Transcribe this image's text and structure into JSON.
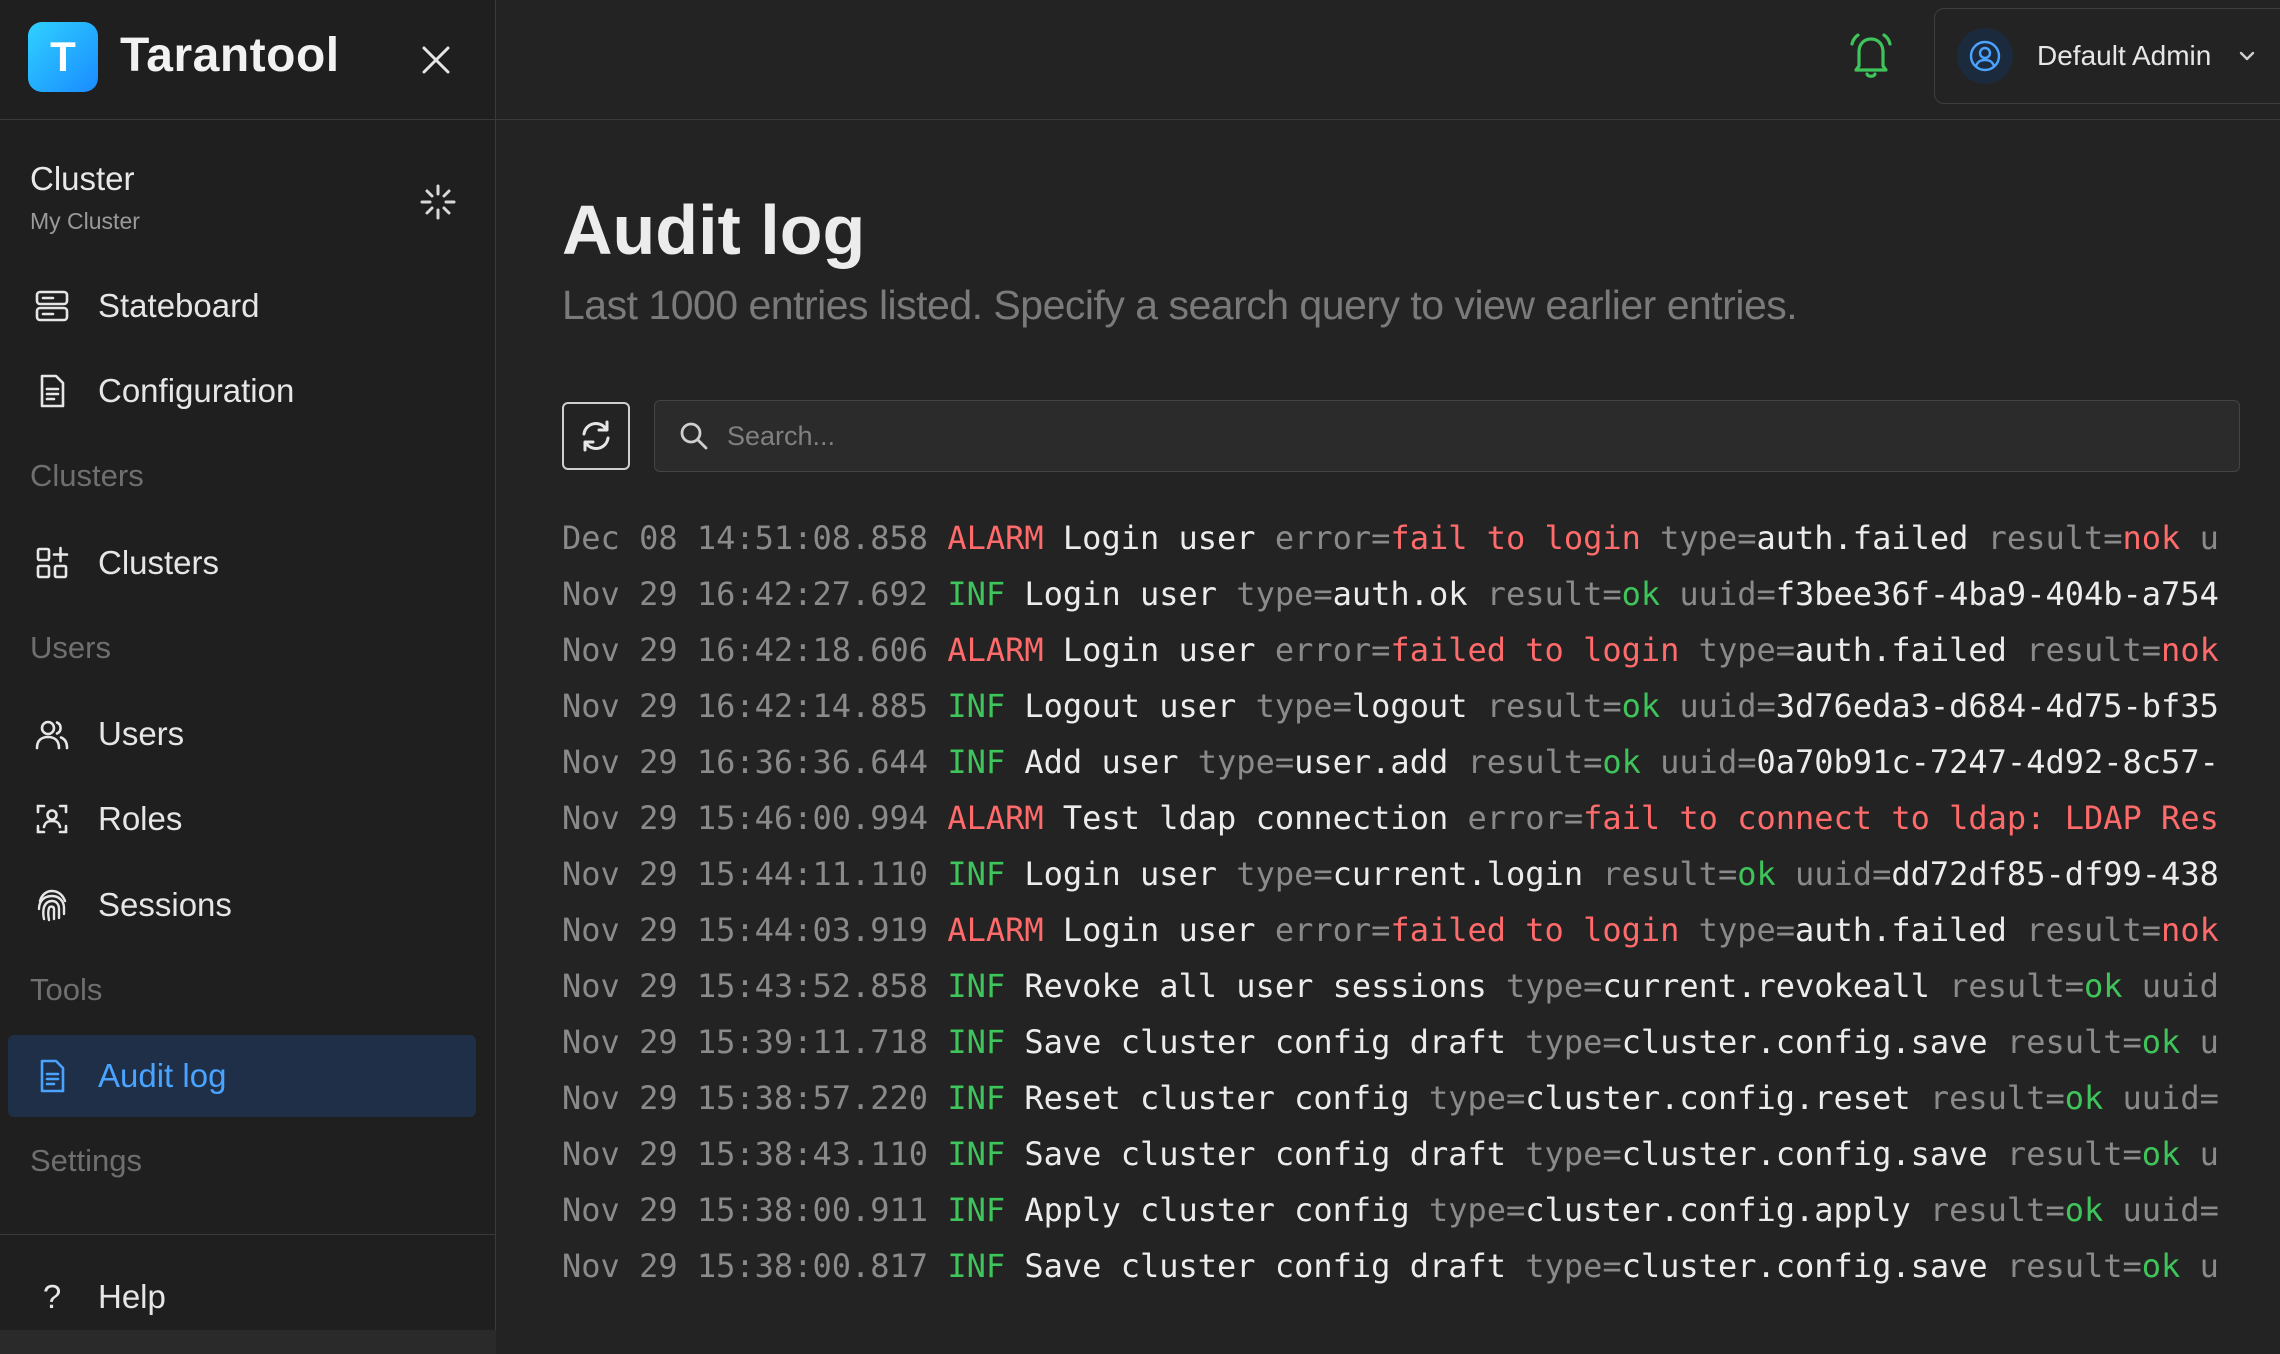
{
  "app": {
    "name": "Tarantool",
    "logo_letter": "T"
  },
  "sidebar": {
    "cluster": {
      "title": "Cluster",
      "subtitle": "My Cluster"
    },
    "items": [
      {
        "label": "Stateboard",
        "icon": "server-icon"
      },
      {
        "label": "Configuration",
        "icon": "document-icon"
      }
    ],
    "sections": {
      "clusters": "Clusters",
      "users": "Users",
      "tools": "Tools",
      "settings": "Settings"
    },
    "clusters_item": {
      "label": "Clusters",
      "icon": "apps-icon"
    },
    "users_items": [
      {
        "label": "Users",
        "icon": "users-icon"
      },
      {
        "label": "Roles",
        "icon": "role-icon"
      },
      {
        "label": "Sessions",
        "icon": "fingerprint-icon"
      }
    ],
    "tools_item": {
      "label": "Audit log",
      "icon": "document-icon",
      "active": true
    },
    "help": {
      "label": "Help",
      "icon": "?"
    }
  },
  "header": {
    "user_name": "Default Admin",
    "accent": "#3ec45a"
  },
  "page": {
    "title": "Audit log",
    "subtitle": "Last 1000 entries listed. Specify a search query to view earlier entries.",
    "search_placeholder": "Search..."
  },
  "colors": {
    "alarm": "#ff6b6b",
    "inf": "#3ec45a",
    "active_bg": "#1e2f47",
    "active_fg": "#4aa3ff"
  },
  "log": [
    {
      "ts": "Dec 08 14:51:08.858",
      "level": "ALARM",
      "message": "Login user",
      "fields": [
        {
          "k": "error",
          "v": "fail to login",
          "t": "err"
        },
        {
          "k": "type",
          "v": "auth.failed",
          "t": ""
        },
        {
          "k": "result",
          "v": "nok",
          "t": "nok"
        },
        {
          "k": "u",
          "v": "",
          "t": ""
        }
      ]
    },
    {
      "ts": "Nov 29 16:42:27.692",
      "level": "INF",
      "message": "Login user",
      "fields": [
        {
          "k": "type",
          "v": "auth.ok",
          "t": ""
        },
        {
          "k": "result",
          "v": "ok",
          "t": "ok"
        },
        {
          "k": "uuid",
          "v": "f3bee36f-4ba9-404b-a754",
          "t": ""
        }
      ]
    },
    {
      "ts": "Nov 29 16:42:18.606",
      "level": "ALARM",
      "message": "Login user",
      "fields": [
        {
          "k": "error",
          "v": "failed to login",
          "t": "err"
        },
        {
          "k": "type",
          "v": "auth.failed",
          "t": ""
        },
        {
          "k": "result",
          "v": "nok",
          "t": "nok"
        }
      ]
    },
    {
      "ts": "Nov 29 16:42:14.885",
      "level": "INF",
      "message": "Logout user",
      "fields": [
        {
          "k": "type",
          "v": "logout",
          "t": ""
        },
        {
          "k": "result",
          "v": "ok",
          "t": "ok"
        },
        {
          "k": "uuid",
          "v": "3d76eda3-d684-4d75-bf35",
          "t": ""
        }
      ]
    },
    {
      "ts": "Nov 29 16:36:36.644",
      "level": "INF",
      "message": "Add user",
      "fields": [
        {
          "k": "type",
          "v": "user.add",
          "t": ""
        },
        {
          "k": "result",
          "v": "ok",
          "t": "ok"
        },
        {
          "k": "uuid",
          "v": "0a70b91c-7247-4d92-8c57-",
          "t": ""
        }
      ]
    },
    {
      "ts": "Nov 29 15:46:00.994",
      "level": "ALARM",
      "message": "Test ldap connection",
      "fields": [
        {
          "k": "error",
          "v": "fail to connect to ldap: LDAP Res",
          "t": "err"
        }
      ]
    },
    {
      "ts": "Nov 29 15:44:11.110",
      "level": "INF",
      "message": "Login user",
      "fields": [
        {
          "k": "type",
          "v": "current.login",
          "t": ""
        },
        {
          "k": "result",
          "v": "ok",
          "t": "ok"
        },
        {
          "k": "uuid",
          "v": "dd72df85-df99-438",
          "t": ""
        }
      ]
    },
    {
      "ts": "Nov 29 15:44:03.919",
      "level": "ALARM",
      "message": "Login user",
      "fields": [
        {
          "k": "error",
          "v": "failed to login",
          "t": "err"
        },
        {
          "k": "type",
          "v": "auth.failed",
          "t": ""
        },
        {
          "k": "result",
          "v": "nok",
          "t": "nok"
        }
      ]
    },
    {
      "ts": "Nov 29 15:43:52.858",
      "level": "INF",
      "message": "Revoke all user sessions",
      "fields": [
        {
          "k": "type",
          "v": "current.revokeall",
          "t": ""
        },
        {
          "k": "result",
          "v": "ok",
          "t": "ok"
        },
        {
          "k": "uuid",
          "v": "",
          "t": ""
        }
      ]
    },
    {
      "ts": "Nov 29 15:39:11.718",
      "level": "INF",
      "message": "Save cluster config draft",
      "fields": [
        {
          "k": "type",
          "v": "cluster.config.save",
          "t": ""
        },
        {
          "k": "result",
          "v": "ok",
          "t": "ok"
        },
        {
          "k": "u",
          "v": "",
          "t": ""
        }
      ]
    },
    {
      "ts": "Nov 29 15:38:57.220",
      "level": "INF",
      "message": "Reset cluster config",
      "fields": [
        {
          "k": "type",
          "v": "cluster.config.reset",
          "t": ""
        },
        {
          "k": "result",
          "v": "ok",
          "t": "ok"
        },
        {
          "k": "uuid=",
          "v": "",
          "t": ""
        }
      ]
    },
    {
      "ts": "Nov 29 15:38:43.110",
      "level": "INF",
      "message": "Save cluster config draft",
      "fields": [
        {
          "k": "type",
          "v": "cluster.config.save",
          "t": ""
        },
        {
          "k": "result",
          "v": "ok",
          "t": "ok"
        },
        {
          "k": "u",
          "v": "",
          "t": ""
        }
      ]
    },
    {
      "ts": "Nov 29 15:38:00.911",
      "level": "INF",
      "message": "Apply cluster config",
      "fields": [
        {
          "k": "type",
          "v": "cluster.config.apply",
          "t": ""
        },
        {
          "k": "result",
          "v": "ok",
          "t": "ok"
        },
        {
          "k": "uuid=",
          "v": "",
          "t": ""
        }
      ]
    },
    {
      "ts": "Nov 29 15:38:00.817",
      "level": "INF",
      "message": "Save cluster config draft",
      "fields": [
        {
          "k": "type",
          "v": "cluster.config.save",
          "t": ""
        },
        {
          "k": "result",
          "v": "ok",
          "t": "ok"
        },
        {
          "k": "u",
          "v": "",
          "t": ""
        }
      ]
    }
  ]
}
